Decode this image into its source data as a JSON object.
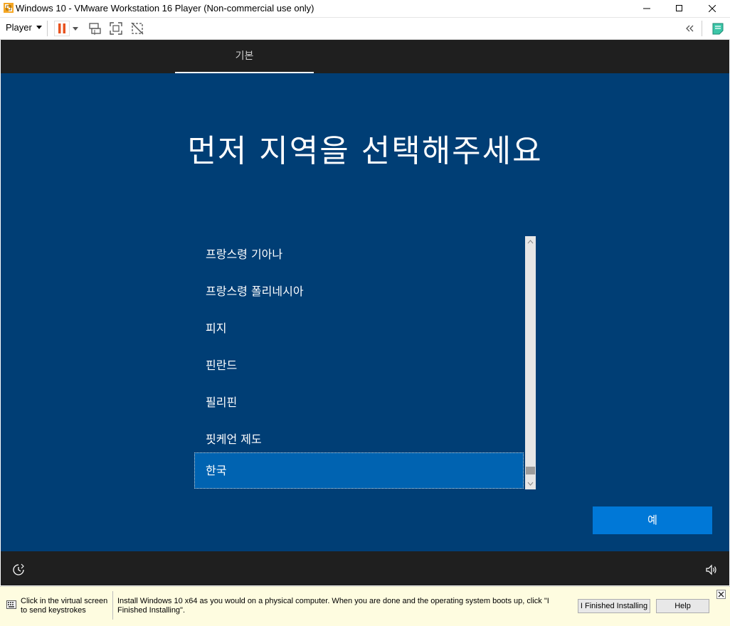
{
  "window": {
    "title": "Windows 10 - VMware Workstation 16 Player (Non-commercial use only)"
  },
  "toolbar": {
    "player_menu": "Player",
    "icons": [
      "pause-icon",
      "send-ctrl-alt-del-icon",
      "fullscreen-icon",
      "unity-icon",
      "collapse-icon",
      "message-log-icon"
    ]
  },
  "setup": {
    "tab_label": "기본",
    "heading": "먼저 지역을 선택해주세요",
    "regions": [
      {
        "label": "프랑스령 기아나",
        "selected": false
      },
      {
        "label": "프랑스령 폴리네시아",
        "selected": false
      },
      {
        "label": "피지",
        "selected": false
      },
      {
        "label": "핀란드",
        "selected": false
      },
      {
        "label": "필리핀",
        "selected": false
      },
      {
        "label": "핏케언 제도",
        "selected": false
      },
      {
        "label": "한국",
        "selected": true
      }
    ],
    "yes_button": "예"
  },
  "hint": {
    "click_text": "Click in the virtual screen to send keystrokes",
    "install_text": "Install Windows 10 x64 as you would on a physical computer. When you are done and the operating system boots up, click \"I Finished Installing\".",
    "finished_button": "I Finished Installing",
    "help_button": "Help"
  },
  "colors": {
    "oobe_background": "#003e75",
    "selected_item": "#0063b1",
    "accent_button": "#0078d7",
    "hint_background": "#fefce0"
  }
}
